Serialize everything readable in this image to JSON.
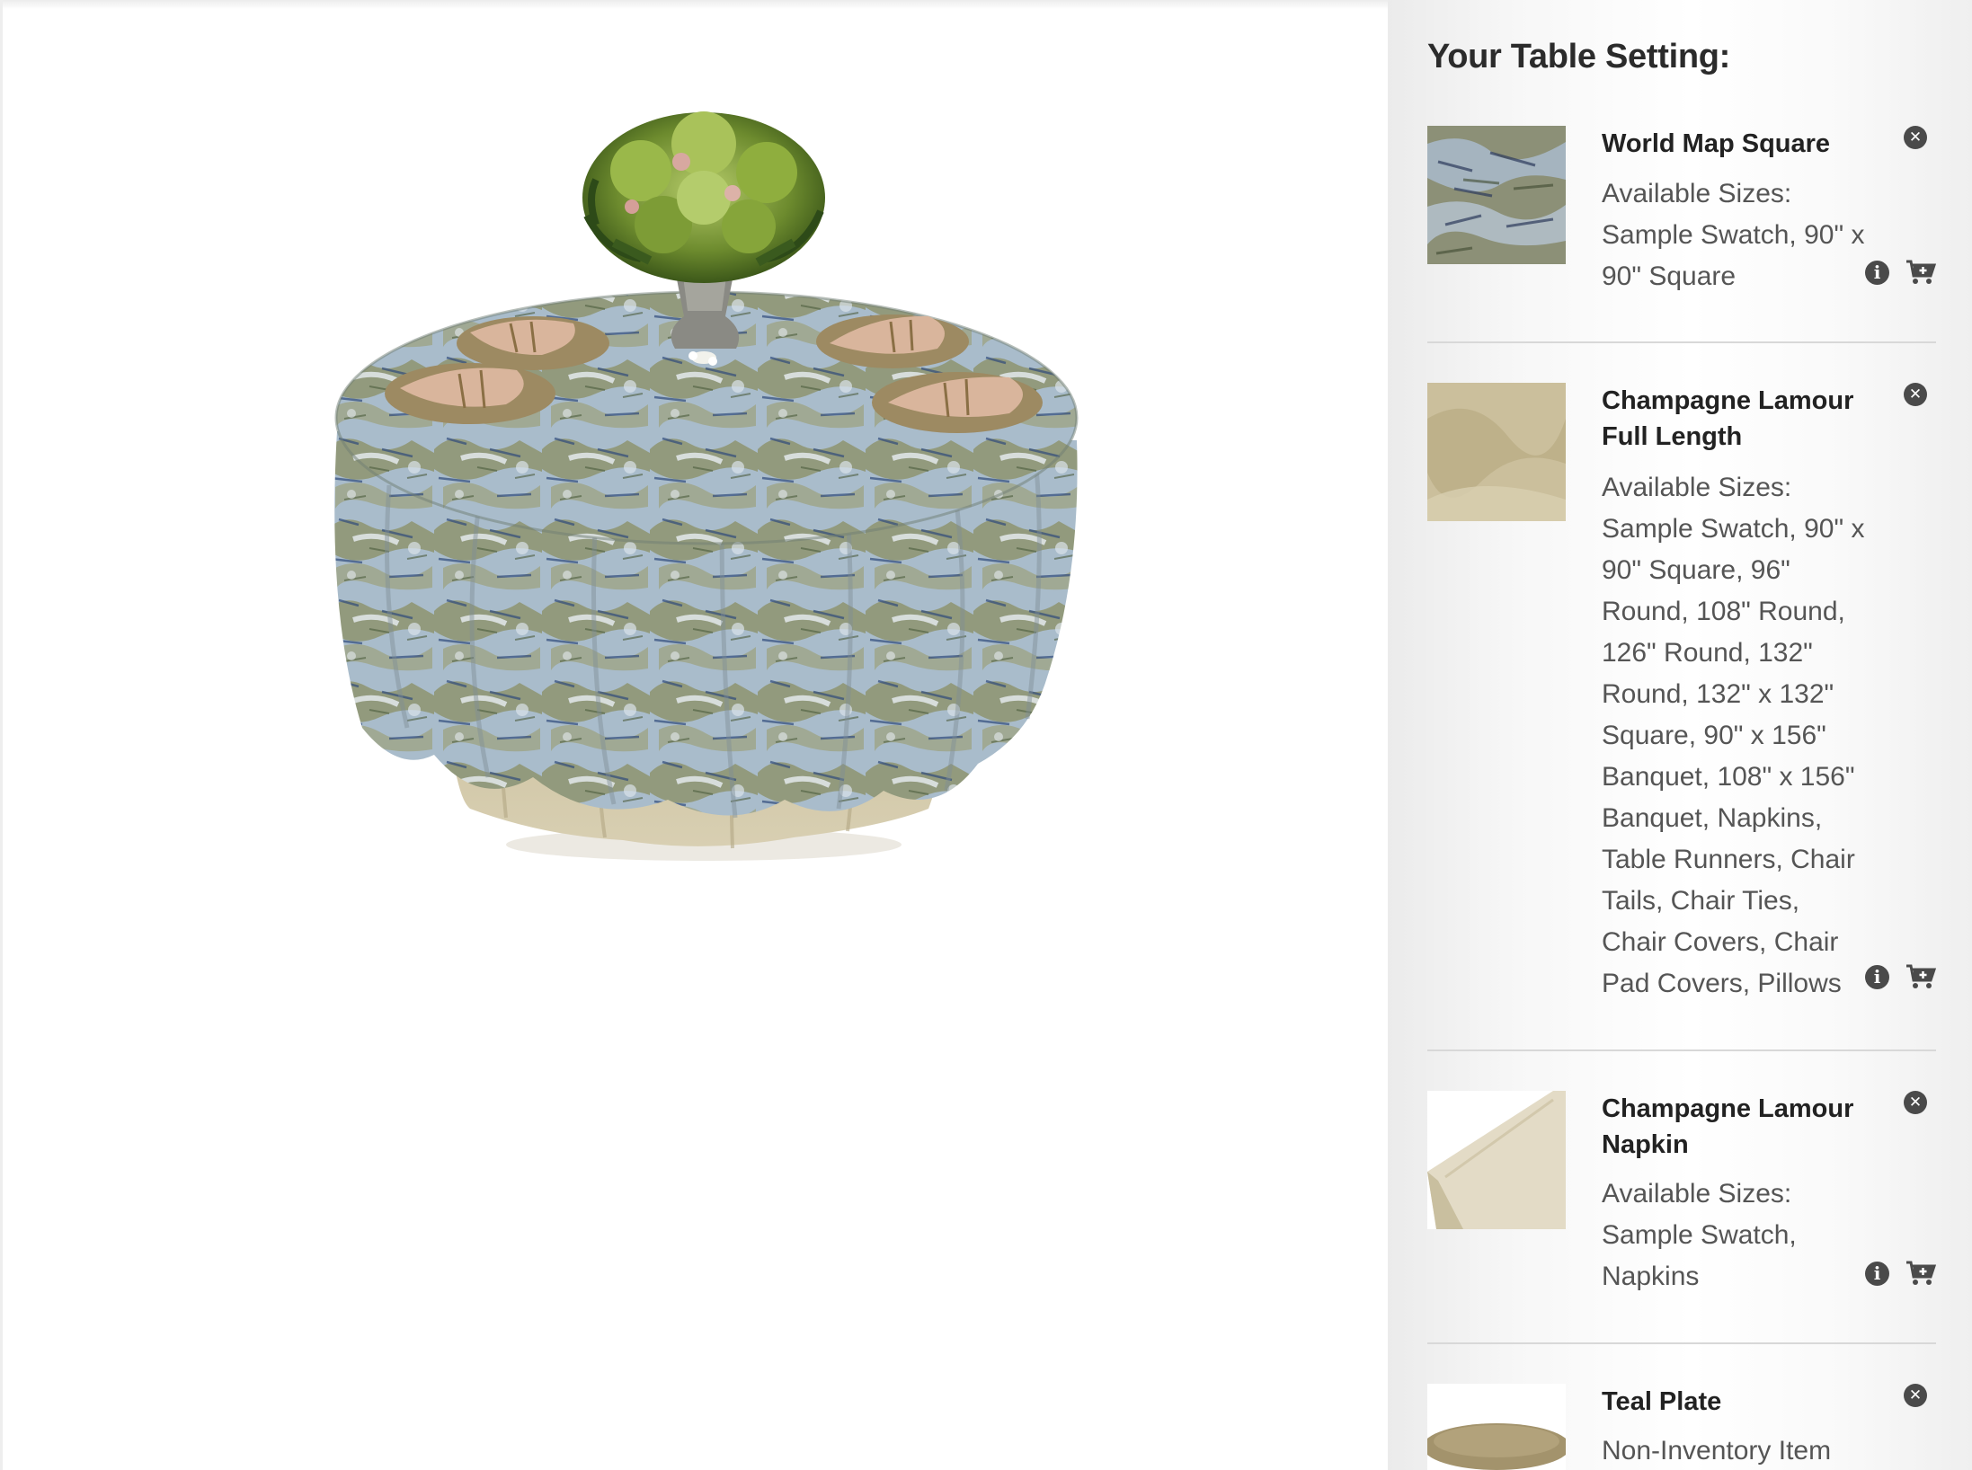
{
  "sidebar": {
    "title": "Your Table Setting:",
    "items": [
      {
        "name": "World Map Square",
        "desc": "Available Sizes: Sample Swatch, 90\" x 90\" Square",
        "thumb": "world-map-fabric",
        "actions": {
          "remove_icon": "close-icon",
          "info_icon": "info-icon",
          "cart_icon": "cart-plus-icon"
        }
      },
      {
        "name": "Champagne Lamour Full Length",
        "desc": "Available Sizes: Sample Swatch, 90\" x 90\" Square, 96\" Round, 108\" Round, 126\" Round, 132\" Round, 132\" x 132\" Square, 90\" x 156\" Banquet, 108\" x 156\" Banquet, Napkins, Table Runners, Chair Tails, Chair Ties, Chair Covers, Chair Pad Covers, Pillows",
        "thumb": "champagne-fabric",
        "actions": {
          "remove_icon": "close-icon",
          "info_icon": "info-icon",
          "cart_icon": "cart-plus-icon"
        }
      },
      {
        "name": "Champagne Lamour Napkin",
        "desc": "Available Sizes: Sample Swatch, Napkins",
        "thumb": "champagne-napkin",
        "actions": {
          "remove_icon": "close-icon",
          "info_icon": "info-icon",
          "cart_icon": "cart-plus-icon"
        }
      },
      {
        "name": "Teal Plate",
        "desc": "Non-Inventory Item",
        "thumb": "plate",
        "actions": {
          "remove_icon": "close-icon"
        }
      }
    ]
  },
  "colors": {
    "overlay_blue": "#a9bccb",
    "overlay_olive": "#8e9470",
    "champagne": "#cbbf9c",
    "napkin_pink": "#d9b59c",
    "charger_gold": "#9d8a62",
    "centerpiece_green": "#6d8b2e"
  }
}
